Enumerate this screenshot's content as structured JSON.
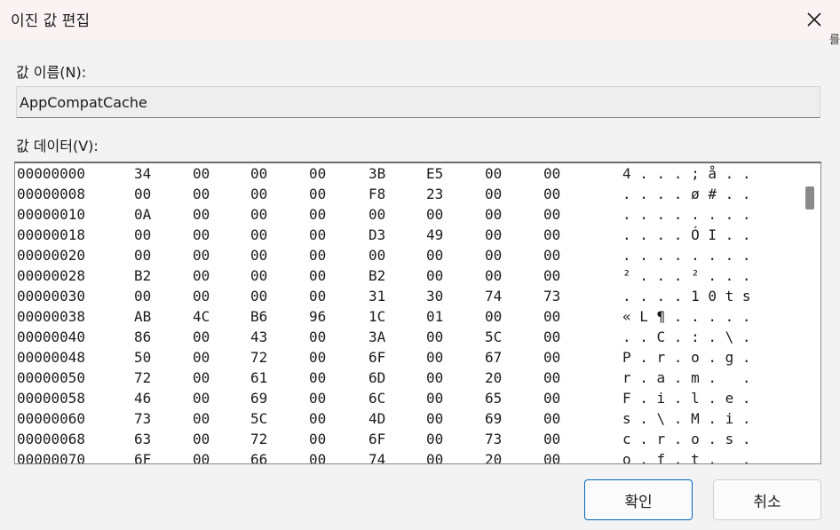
{
  "dialog": {
    "title": "이진 값 편집",
    "close_icon": "close-icon",
    "value_name_label": "값 이름(N):",
    "value_name": "AppCompatCache",
    "value_data_label": "값 데이터(V):",
    "ok_label": "확인",
    "cancel_label": "취소",
    "edge_glyph": "를"
  },
  "hex_rows": [
    {
      "offset": "00000000",
      "bytes": [
        "34",
        "00",
        "00",
        "00",
        "3B",
        "E5",
        "00",
        "00"
      ],
      "ascii": "4 . . . ; å . ."
    },
    {
      "offset": "00000008",
      "bytes": [
        "00",
        "00",
        "00",
        "00",
        "F8",
        "23",
        "00",
        "00"
      ],
      "ascii": ". . . . ø # . ."
    },
    {
      "offset": "00000010",
      "bytes": [
        "0A",
        "00",
        "00",
        "00",
        "00",
        "00",
        "00",
        "00"
      ],
      "ascii": ". . . . . . . ."
    },
    {
      "offset": "00000018",
      "bytes": [
        "00",
        "00",
        "00",
        "00",
        "D3",
        "49",
        "00",
        "00"
      ],
      "ascii": ". . . . Ó I . ."
    },
    {
      "offset": "00000020",
      "bytes": [
        "00",
        "00",
        "00",
        "00",
        "00",
        "00",
        "00",
        "00"
      ],
      "ascii": ". . . . . . . ."
    },
    {
      "offset": "00000028",
      "bytes": [
        "B2",
        "00",
        "00",
        "00",
        "B2",
        "00",
        "00",
        "00"
      ],
      "ascii": "² . . . ² . . ."
    },
    {
      "offset": "00000030",
      "bytes": [
        "00",
        "00",
        "00",
        "00",
        "31",
        "30",
        "74",
        "73"
      ],
      "ascii": ". . . . 1 0 t s"
    },
    {
      "offset": "00000038",
      "bytes": [
        "AB",
        "4C",
        "B6",
        "96",
        "1C",
        "01",
        "00",
        "00"
      ],
      "ascii": "« L ¶ . . . . ."
    },
    {
      "offset": "00000040",
      "bytes": [
        "86",
        "00",
        "43",
        "00",
        "3A",
        "00",
        "5C",
        "00"
      ],
      "ascii": ". . C . : . \\ ."
    },
    {
      "offset": "00000048",
      "bytes": [
        "50",
        "00",
        "72",
        "00",
        "6F",
        "00",
        "67",
        "00"
      ],
      "ascii": "P . r . o . g ."
    },
    {
      "offset": "00000050",
      "bytes": [
        "72",
        "00",
        "61",
        "00",
        "6D",
        "00",
        "20",
        "00"
      ],
      "ascii": "r . a . m .   ."
    },
    {
      "offset": "00000058",
      "bytes": [
        "46",
        "00",
        "69",
        "00",
        "6C",
        "00",
        "65",
        "00"
      ],
      "ascii": "F . i . l . e ."
    },
    {
      "offset": "00000060",
      "bytes": [
        "73",
        "00",
        "5C",
        "00",
        "4D",
        "00",
        "69",
        "00"
      ],
      "ascii": "s . \\ . M . i ."
    },
    {
      "offset": "00000068",
      "bytes": [
        "63",
        "00",
        "72",
        "00",
        "6F",
        "00",
        "73",
        "00"
      ],
      "ascii": "c . r . o . s ."
    },
    {
      "offset": "00000070",
      "bytes": [
        "6F",
        "00",
        "66",
        "00",
        "74",
        "00",
        "20",
        "00"
      ],
      "ascii": "o . f . t .   ."
    }
  ]
}
